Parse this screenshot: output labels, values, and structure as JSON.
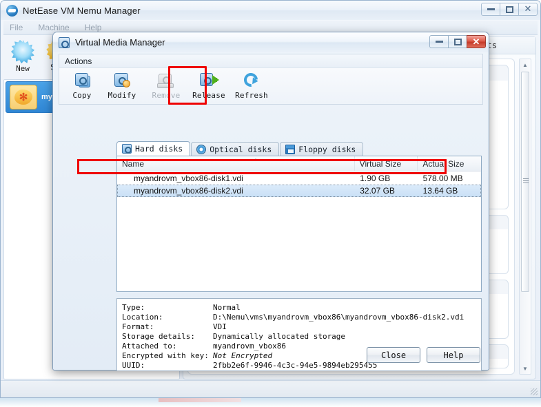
{
  "app": {
    "title": "NetEase VM Nemu Manager",
    "icon": "netease-logo-icon",
    "window_buttons": {
      "minimize": "minimize-icon",
      "maximize": "maximize-icon",
      "close": "close-icon"
    },
    "menu": [
      "File",
      "Machine",
      "Help"
    ],
    "toolbar": [
      {
        "label": "New",
        "icon": "new-star-icon"
      },
      {
        "label": "Set",
        "icon": "settings-gear-icon"
      }
    ],
    "vm_list": [
      {
        "name": "my...",
        "state_icon": "powered-off-icon",
        "selected": true
      }
    ],
    "detail_tab": "pshots",
    "scrollbar": {
      "up": "▲",
      "down": "▼"
    }
  },
  "dialog": {
    "title": "Virtual Media Manager",
    "icon": "virtual-media-manager-icon",
    "actions_group_label": "Actions",
    "toolbar": [
      {
        "label": "Copy",
        "icon": "copy-disk-icon",
        "enabled": true,
        "highlighted": false
      },
      {
        "label": "Modify",
        "icon": "modify-disk-icon",
        "enabled": true,
        "highlighted": false
      },
      {
        "label": "Remove",
        "icon": "remove-disk-icon",
        "enabled": false,
        "highlighted": false
      },
      {
        "label": "Release",
        "icon": "release-disk-icon",
        "enabled": true,
        "highlighted": true
      },
      {
        "label": "Refresh",
        "icon": "refresh-icon",
        "enabled": true,
        "highlighted": false
      }
    ],
    "tabs": [
      {
        "label": "Hard disks",
        "icon": "hard-disk-icon",
        "active": true
      },
      {
        "label": "Optical disks",
        "icon": "optical-disk-icon",
        "active": false
      },
      {
        "label": "Floppy disks",
        "icon": "floppy-disk-icon",
        "active": false
      }
    ],
    "table": {
      "columns": [
        "Name",
        "Virtual Size",
        "Actual Size"
      ],
      "sort_column": "Name",
      "sort_direction": "ascending",
      "rows": [
        {
          "name": "myandrovm_vbox86-disk1.vdi",
          "virtual_size": "1.90 GB",
          "actual_size": "578.00 MB",
          "selected": false
        },
        {
          "name": "myandrovm_vbox86-disk2.vdi",
          "virtual_size": "32.07 GB",
          "actual_size": "13.64 GB",
          "selected": true
        }
      ]
    },
    "info": [
      {
        "label": "Type:",
        "value": "Normal",
        "italic": false
      },
      {
        "label": "Location:",
        "value": "D:\\Nemu\\vms\\myandrovm_vbox86\\myandrovm_vbox86-disk2.vdi",
        "italic": false
      },
      {
        "label": "Format:",
        "value": "VDI",
        "italic": false
      },
      {
        "label": "Storage details:",
        "value": "Dynamically allocated storage",
        "italic": false
      },
      {
        "label": "Attached to:",
        "value": "myandrovm_vbox86",
        "italic": false
      },
      {
        "label": "Encrypted with key:",
        "value": "Not Encrypted",
        "italic": true
      },
      {
        "label": "UUID:",
        "value": "2fbb2e6f-9946-4c3c-94e5-9894eb295455",
        "italic": false
      }
    ],
    "buttons": [
      {
        "label": "Close"
      },
      {
        "label": "Help"
      }
    ],
    "window_buttons": {
      "minimize": "minimize-icon",
      "maximize": "maximize-icon",
      "close": "close-icon"
    }
  },
  "annotations": {
    "highlight_color": "#ef0000",
    "highlighted_toolbar_button": "Release",
    "highlighted_table_row": "myandrovm_vbox86-disk2.vdi"
  }
}
